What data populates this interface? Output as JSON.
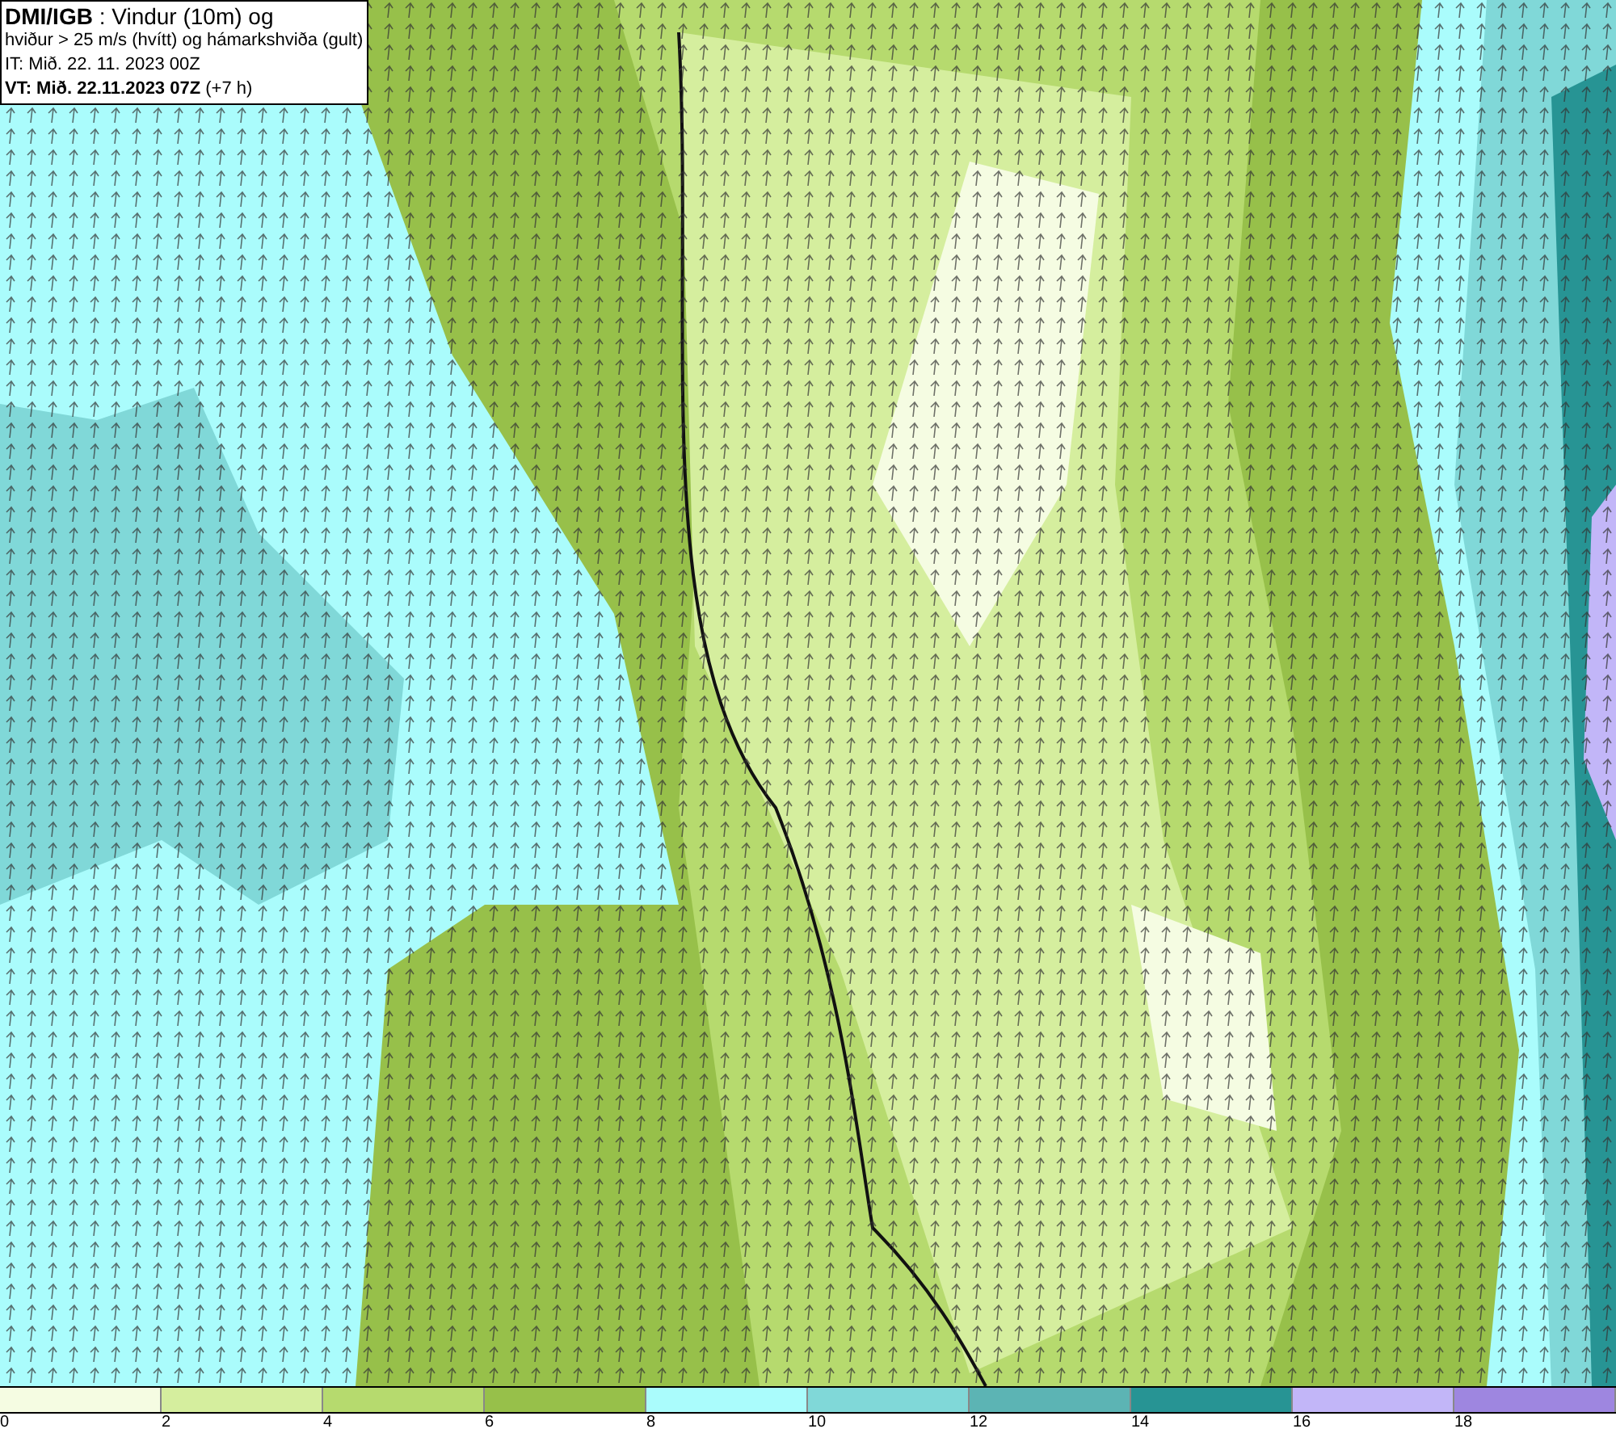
{
  "header": {
    "lines": [
      "**DMI/IGB** : Vindur (10m) og",
      "hviður > 25 m/s (hvítt) og hámarkshviða (gult)",
      "IT: Mið. 22. 11. 2023 00Z",
      "**VT: Mið. 22.11.2023 07Z** (+7 h)"
    ]
  },
  "legend": {
    "segments": [
      {
        "color": "#f5fce2"
      },
      {
        "color": "#d5ee9e"
      },
      {
        "color": "#b6da6e"
      },
      {
        "color": "#97c04a"
      },
      {
        "color": "#aafcfc"
      },
      {
        "color": "#80d8d8"
      },
      {
        "color": "#5cb4b4"
      },
      {
        "color": "#279494"
      },
      {
        "color": "#c2b6f8"
      },
      {
        "color": "#9e86e0"
      }
    ],
    "ticks": [
      "0",
      "2",
      "4",
      "6",
      "8",
      "10",
      "12",
      "14",
      "16",
      "18"
    ]
  }
}
